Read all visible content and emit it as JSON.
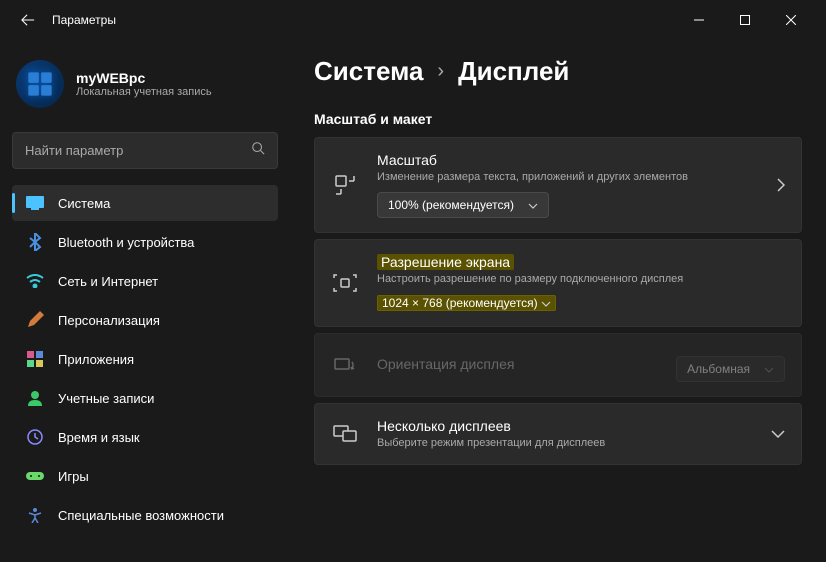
{
  "titlebar": {
    "title": "Параметры"
  },
  "user": {
    "name": "myWEBpc",
    "account_type": "Локальная учетная запись"
  },
  "search": {
    "placeholder": "Найти параметр"
  },
  "nav": [
    {
      "label": "Система",
      "icon": "system",
      "active": true
    },
    {
      "label": "Bluetooth и устройства",
      "icon": "bluetooth"
    },
    {
      "label": "Сеть и Интернет",
      "icon": "wifi"
    },
    {
      "label": "Персонализация",
      "icon": "personalize"
    },
    {
      "label": "Приложения",
      "icon": "apps"
    },
    {
      "label": "Учетные записи",
      "icon": "accounts"
    },
    {
      "label": "Время и язык",
      "icon": "time"
    },
    {
      "label": "Игры",
      "icon": "gaming"
    },
    {
      "label": "Специальные возможности",
      "icon": "accessibility"
    }
  ],
  "breadcrumb": {
    "root": "Система",
    "current": "Дисплей"
  },
  "section": {
    "title": "Масштаб и макет"
  },
  "cards": {
    "scale": {
      "title": "Масштаб",
      "desc": "Изменение размера текста, приложений и других элементов",
      "value": "100% (рекомендуется)"
    },
    "resolution": {
      "title": "Разрешение экрана",
      "desc": "Настроить разрешение по размеру подключенного дисплея",
      "value": "1024 × 768 (рекомендуется)"
    },
    "orientation": {
      "title": "Ориентация дисплея",
      "value": "Альбомная"
    },
    "multiple": {
      "title": "Несколько дисплеев",
      "desc": "Выберите режим презентации для дисплеев"
    }
  }
}
